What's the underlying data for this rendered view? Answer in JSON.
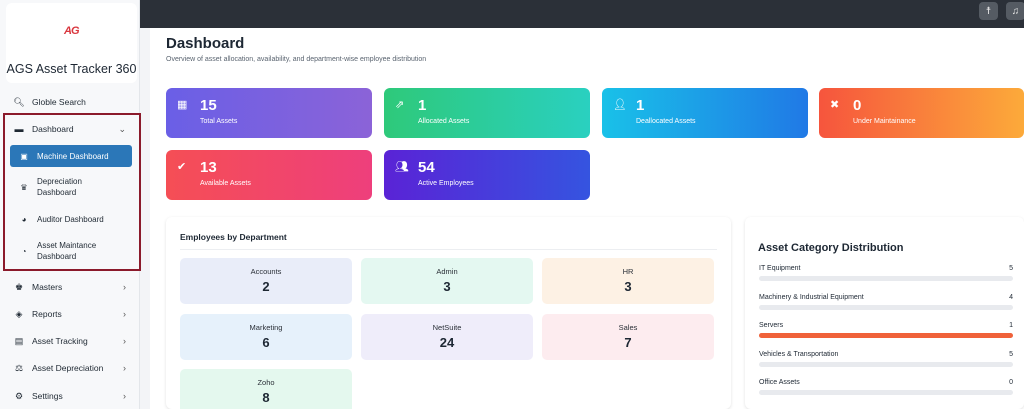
{
  "app": {
    "logo": "AG",
    "title": "AGS Asset Tracker 360"
  },
  "sidebar": {
    "search": "Globle Search",
    "dashboard": "Dashboard",
    "dashboard_sub": [
      "Machine Dashboard",
      "Depreciation Dashboard",
      "Auditor Dashboard",
      "Asset Maintance Dashboard"
    ],
    "masters": "Masters",
    "reports": "Reports",
    "asset_tracking": "Asset Tracking",
    "asset_depreciation": "Asset Depreciation",
    "settings": "Settings"
  },
  "header": {
    "title": "Dashboard",
    "subtitle": "Overview of asset allocation, availability, and department-wise employee distribution"
  },
  "stats": [
    {
      "value": "15",
      "label": "Total Assets",
      "icon": "boxes-icon"
    },
    {
      "value": "1",
      "label": "Allocated Assets",
      "icon": "share-icon"
    },
    {
      "value": "1",
      "label": "Deallocated Assets",
      "icon": "user-minus-icon"
    },
    {
      "value": "0",
      "label": "Under Maintainance",
      "icon": "tools-icon"
    },
    {
      "value": "13",
      "label": "Available Assets",
      "icon": "check-circle-icon"
    },
    {
      "value": "54",
      "label": "Active Employees",
      "icon": "users-icon"
    }
  ],
  "departments": {
    "title": "Employees by Department",
    "items": [
      {
        "name": "Accounts",
        "count": "2"
      },
      {
        "name": "Admin",
        "count": "3"
      },
      {
        "name": "HR",
        "count": "3"
      },
      {
        "name": "Marketing",
        "count": "6"
      },
      {
        "name": "NetSuite",
        "count": "24"
      },
      {
        "name": "Sales",
        "count": "7"
      },
      {
        "name": "Zoho",
        "count": "8"
      }
    ]
  },
  "categories": {
    "title": "Asset Category Distribution",
    "items": [
      {
        "name": "IT Equipment",
        "count": "5",
        "fill": 0
      },
      {
        "name": "Machinery & Industrial Equipment",
        "count": "4",
        "fill": 0
      },
      {
        "name": "Servers",
        "count": "1",
        "fill": 1
      },
      {
        "name": "Vehicles & Transportation",
        "count": "5",
        "fill": 0
      },
      {
        "name": "Office Assets",
        "count": "0",
        "fill": 0
      }
    ]
  },
  "colors": {
    "accent": "#2b77b8",
    "highlight_border": "#8b1a2b",
    "bar_fill": "#f0623a"
  }
}
